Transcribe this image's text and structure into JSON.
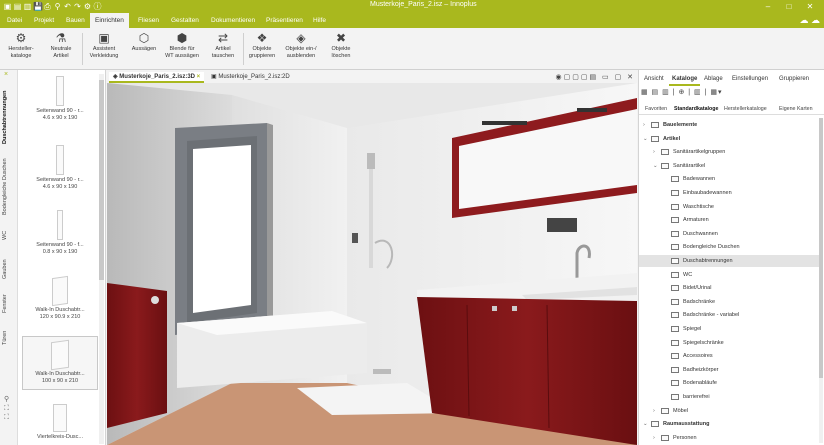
{
  "titlebar": {
    "title": "Musterkoje_Paris_2.isz – Innoplus",
    "quick_icons": [
      "app-logo-icon",
      "new-file-icon",
      "open-icon",
      "save-icon",
      "print-icon",
      "search-icon",
      "undo-icon",
      "redo-icon",
      "settings-icon",
      "info-icon"
    ],
    "controls": [
      "–",
      "□",
      "✕"
    ]
  },
  "menu": {
    "tabs": [
      "Datei",
      "Projekt",
      "Bauen",
      "Einrichten",
      "Fliesen",
      "Gestalten",
      "Dokumentieren",
      "Präsentieren",
      "Hilfe"
    ],
    "active": "Einrichten"
  },
  "ribbon": {
    "buttons": [
      {
        "icon": "manufacturer-catalog-icon",
        "label": "Hersteller-\nkataloge"
      },
      {
        "icon": "neutral-article-icon",
        "label": "Neutrale\nArtikel"
      },
      {
        "icon": "assistant-icon",
        "label": "Assistent\nVerkleidung"
      },
      {
        "icon": "cutout-icon",
        "label": "Aussägen"
      },
      {
        "icon": "cover-panel-icon",
        "label": "Blende für\nWT aussägen"
      },
      {
        "icon": "swap-article-icon",
        "label": "Artikel\ntauschen"
      },
      {
        "icon": "group-objects-icon",
        "label": "Objekte\ngruppieren"
      },
      {
        "icon": "show-hide-icon",
        "label": "Objekte ein-/\nausblenden"
      },
      {
        "icon": "delete-objects-icon",
        "label": "Objekte\nlöschen"
      }
    ]
  },
  "left_panel": {
    "vertical_tabs": [
      "Duschabtrennungen",
      "Bodengleiche Duschen",
      "WC",
      "Gauben",
      "Fenster",
      "Türen"
    ],
    "active_tab": "Duschabtrennungen",
    "items": [
      {
        "name": "Seitenwand 90 - r...",
        "dims": "4.6 x 90 x 190"
      },
      {
        "name": "Seitenwand 90 - r...",
        "dims": "4.6 x 90 x 190"
      },
      {
        "name": "Seitenwand 90 - f...",
        "dims": "0.8 x 90 x 190"
      },
      {
        "name": "Walk-In Duschabtr...",
        "dims": "120 x 90.9 x 210"
      },
      {
        "name": "Walk-In Duschabtr...",
        "dims": "100 x 90 x 210"
      },
      {
        "name": "Viertelkreis-Dusc...",
        "dims": ""
      }
    ]
  },
  "doc_tabs": [
    {
      "label": "Musterkoje_Paris_2.isz:3D",
      "active": true
    },
    {
      "label": "Musterkoje_Paris_2.isz:2D",
      "active": false
    }
  ],
  "right_panel": {
    "tabs": [
      "Ansicht",
      "Kataloge",
      "Ablage",
      "Einstellungen",
      "Gruppieren"
    ],
    "active_tab": "Kataloge",
    "subtabs": [
      "Favoriten",
      "Standardkataloge",
      "Herstellerkataloge",
      "Eigene Karten"
    ],
    "active_subtab": "Standardkataloge",
    "tree": [
      {
        "label": "Bauelemente",
        "level": 0,
        "expanded": false,
        "bold": true
      },
      {
        "label": "Artikel",
        "level": 0,
        "expanded": true,
        "bold": true
      },
      {
        "label": "Sanitärartikelgruppen",
        "level": 1,
        "expanded": false
      },
      {
        "label": "Sanitärartikel",
        "level": 1,
        "expanded": true
      },
      {
        "label": "Badewannen",
        "level": 2
      },
      {
        "label": "Einbaubadewannen",
        "level": 2
      },
      {
        "label": "Waschtische",
        "level": 2
      },
      {
        "label": "Armaturen",
        "level": 2
      },
      {
        "label": "Duschwannen",
        "level": 2
      },
      {
        "label": "Bodengleiche Duschen",
        "level": 2
      },
      {
        "label": "Duschabtrennungen",
        "level": 2,
        "selected": true
      },
      {
        "label": "WC",
        "level": 2
      },
      {
        "label": "Bidet/Urinal",
        "level": 2
      },
      {
        "label": "Badschränke",
        "level": 2
      },
      {
        "label": "Badschränke - variabel",
        "level": 2
      },
      {
        "label": "Spiegel",
        "level": 2
      },
      {
        "label": "Spiegelschränke",
        "level": 2
      },
      {
        "label": "Accessoires",
        "level": 2
      },
      {
        "label": "Badheizkörper",
        "level": 2
      },
      {
        "label": "Bodenabläufe",
        "level": 2
      },
      {
        "label": "barrierefrei",
        "level": 2
      },
      {
        "label": "Möbel",
        "level": 1,
        "expanded": false
      },
      {
        "label": "Raumausstattung",
        "level": 0,
        "expanded": true,
        "bold": true
      },
      {
        "label": "Personen",
        "level": 1,
        "expanded": false
      }
    ]
  },
  "colors": {
    "brand": "#a9b81e",
    "cabinet": "#7e1416",
    "mirror_frame": "#8e1b1e",
    "floor": "#c99575",
    "window_frame": "#7a7e84"
  }
}
